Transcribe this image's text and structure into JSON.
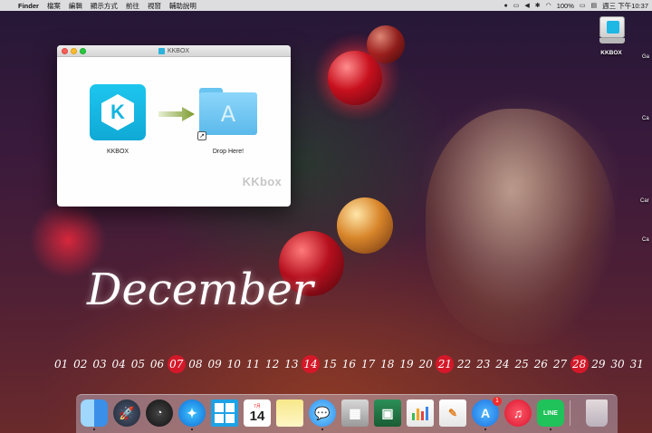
{
  "menubar": {
    "app_name": "Finder",
    "menus": [
      "檔案",
      "編輯",
      "顯示方式",
      "前往",
      "視窗",
      "輔助說明"
    ],
    "battery": "100%",
    "clock": "週三 下午10:37"
  },
  "window": {
    "title": "KKBOX",
    "app_label": "KKBOX",
    "folder_label": "Drop Here!",
    "watermark": "KKbox"
  },
  "desktop": {
    "drive_label": "KKBOX",
    "edge_labels": [
      "Ga",
      "Ca",
      "Car",
      "Ca"
    ]
  },
  "wallpaper": {
    "month": "December",
    "dates": [
      "01",
      "02",
      "03",
      "04",
      "05",
      "06",
      "07",
      "08",
      "09",
      "10",
      "11",
      "12",
      "13",
      "14",
      "15",
      "16",
      "17",
      "18",
      "19",
      "20",
      "21",
      "22",
      "23",
      "24",
      "25",
      "26",
      "27",
      "28",
      "29",
      "30",
      "31"
    ],
    "highlighted_dates": [
      "07",
      "14",
      "21",
      "28"
    ]
  },
  "dock": {
    "calendar_day": "14",
    "calendar_month": "7月",
    "app_store_badge": "1",
    "line_label": "LINE"
  }
}
